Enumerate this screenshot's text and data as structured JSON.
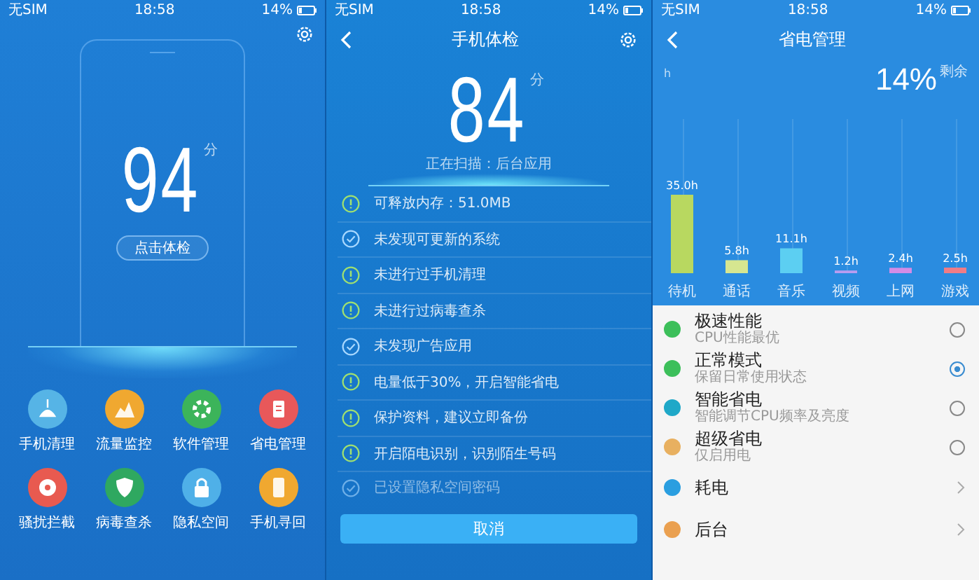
{
  "home": {
    "status_bar": {
      "carrier": "无SIM",
      "time": "18:58",
      "battery": "14%"
    },
    "score": "94",
    "score_unit": "分",
    "check_button": "点击体检",
    "tools": [
      {
        "label": "手机清理",
        "color": "#56b4e6"
      },
      {
        "label": "流量监控",
        "color": "#f0a830"
      },
      {
        "label": "软件管理",
        "color": "#3cb45a"
      },
      {
        "label": "省电管理",
        "color": "#e8585a"
      },
      {
        "label": "骚扰拦截",
        "color": "#e85a50"
      },
      {
        "label": "病毒查杀",
        "color": "#2fa860"
      },
      {
        "label": "隐私空间",
        "color": "#4fb0e8"
      },
      {
        "label": "手机寻回",
        "color": "#f0a830"
      }
    ]
  },
  "scan": {
    "status_bar": {
      "carrier": "无SIM",
      "time": "18:58",
      "battery": "14%"
    },
    "title": "手机体检",
    "score": "84",
    "score_unit": "分",
    "scanning": "正在扫描：后台应用",
    "items": [
      {
        "text": "可释放内存：51.0MB",
        "kind": "warning"
      },
      {
        "text": "未发现可更新的系统",
        "kind": "ok"
      },
      {
        "text": "未进行过手机清理",
        "kind": "warning"
      },
      {
        "text": "未进行过病毒查杀",
        "kind": "warning"
      },
      {
        "text": "未发现广告应用",
        "kind": "ok"
      },
      {
        "text": "电量低于30%，开启智能省电",
        "kind": "warning"
      },
      {
        "text": "保护资料，建议立即备份",
        "kind": "warning"
      },
      {
        "text": "开启陌电识别，识别陌生号码",
        "kind": "warning"
      },
      {
        "text": "已设置隐私空间密码",
        "kind": "ok"
      }
    ],
    "cancel_button": "取消"
  },
  "power": {
    "status_bar": {
      "carrier": "无SIM",
      "time": "18:58",
      "battery": "14%"
    },
    "title": "省电管理",
    "remaining": "14%",
    "remaining_label": "剩余",
    "chart_data": {
      "type": "bar",
      "grid": true,
      "annotations": [
        {
          "text": "h"
        }
      ],
      "categories": [
        "待机",
        "通话",
        "音乐",
        "视频",
        "上网",
        "游戏"
      ],
      "series": [
        {
          "color": "#b8d860",
          "values": [
            35.0,
            null,
            null,
            null,
            null,
            null
          ],
          "value_labels": [
            "35.0h",
            null,
            null,
            null,
            null,
            null
          ]
        },
        {
          "color": "#d6e690",
          "values": [
            null,
            5.8,
            null,
            null,
            null,
            null
          ],
          "value_labels": [
            null,
            "5.8h",
            null,
            null,
            null,
            null
          ]
        },
        {
          "color": "#5ccff2",
          "values": [
            null,
            null,
            11.1,
            null,
            null,
            null
          ],
          "value_labels": [
            null,
            null,
            "11.1h",
            null,
            null,
            null
          ]
        },
        {
          "color": "#b89cf0",
          "values": [
            null,
            null,
            null,
            1.2,
            null,
            null
          ],
          "value_labels": [
            null,
            null,
            null,
            "1.2h",
            null,
            null
          ]
        },
        {
          "color": "#d38ce6",
          "values": [
            null,
            null,
            null,
            null,
            2.4,
            null
          ],
          "value_labels": [
            null,
            null,
            null,
            null,
            "2.4h",
            null
          ]
        },
        {
          "color": "#f07c86",
          "values": [
            null,
            null,
            null,
            null,
            null,
            2.5
          ],
          "value_labels": [
            null,
            null,
            null,
            null,
            null,
            "2.5h"
          ]
        }
      ]
    },
    "modes": [
      {
        "kind": "mode",
        "title": "极速性能",
        "subtitle": "CPU性能最优",
        "color": "#3cbf5a",
        "selected": false
      },
      {
        "kind": "mode",
        "title": "正常模式",
        "subtitle": "保留日常使用状态",
        "color": "#3cbf5a",
        "selected": true
      },
      {
        "kind": "mode",
        "title": "智能省电",
        "subtitle": "智能调节CPU频率及亮度",
        "color": "#1fa8c8",
        "selected": false
      },
      {
        "kind": "mode",
        "title": "超级省电",
        "subtitle": "仅启用电",
        "color": "#e8b060",
        "selected": false
      },
      {
        "kind": "link",
        "title": "耗电",
        "color": "#2a9ee0"
      },
      {
        "kind": "link",
        "title": "后台",
        "color": "#eaa050"
      }
    ]
  }
}
